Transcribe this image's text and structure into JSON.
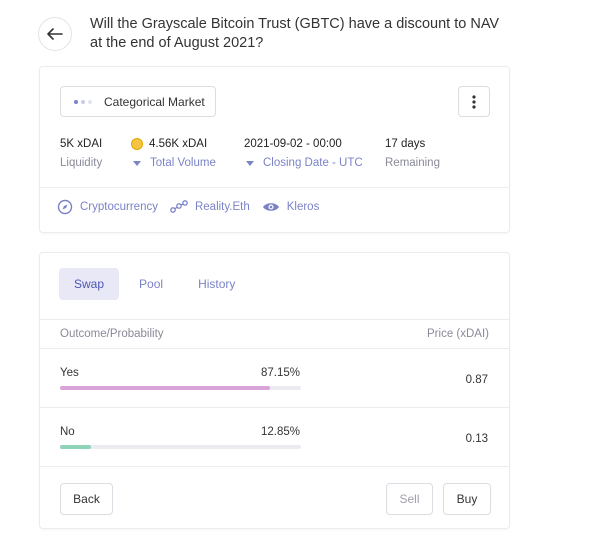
{
  "header": {
    "title": "Will the Grayscale Bitcoin Trust (GBTC) have a discount to NAV at the end of August 2021?"
  },
  "market": {
    "type_label": "Categorical Market"
  },
  "stats": [
    {
      "value": "5K xDAI",
      "label": "Liquidity"
    },
    {
      "value": "4.56K xDAI",
      "label": "Total Volume"
    },
    {
      "value": "2021-09-02 - 00:00",
      "label": "Closing Date - UTC"
    },
    {
      "value": "17 days",
      "label": "Remaining"
    }
  ],
  "tags": [
    {
      "label": "Cryptocurrency",
      "icon": "compass-icon"
    },
    {
      "label": "Reality.Eth",
      "icon": "nodes-icon"
    },
    {
      "label": "Kleros",
      "icon": "eye-icon"
    }
  ],
  "tabs": [
    {
      "label": "Swap",
      "active": true
    },
    {
      "label": "Pool",
      "active": false
    },
    {
      "label": "History",
      "active": false
    }
  ],
  "table": {
    "header_left": "Outcome/Probability",
    "header_right": "Price (xDAI)",
    "rows": [
      {
        "name": "Yes",
        "probability": "87.15%",
        "probability_value": 0.8715,
        "price": "0.87",
        "color": "#d9a5d9"
      },
      {
        "name": "No",
        "probability": "12.85%",
        "probability_value": 0.1285,
        "price": "0.13",
        "color": "#8fd3b8"
      }
    ]
  },
  "actions": {
    "back": "Back",
    "sell": "Sell",
    "buy": "Buy"
  },
  "colors": {
    "accent": "#7b83c7",
    "tab_active_bg": "#e8e8f6"
  }
}
